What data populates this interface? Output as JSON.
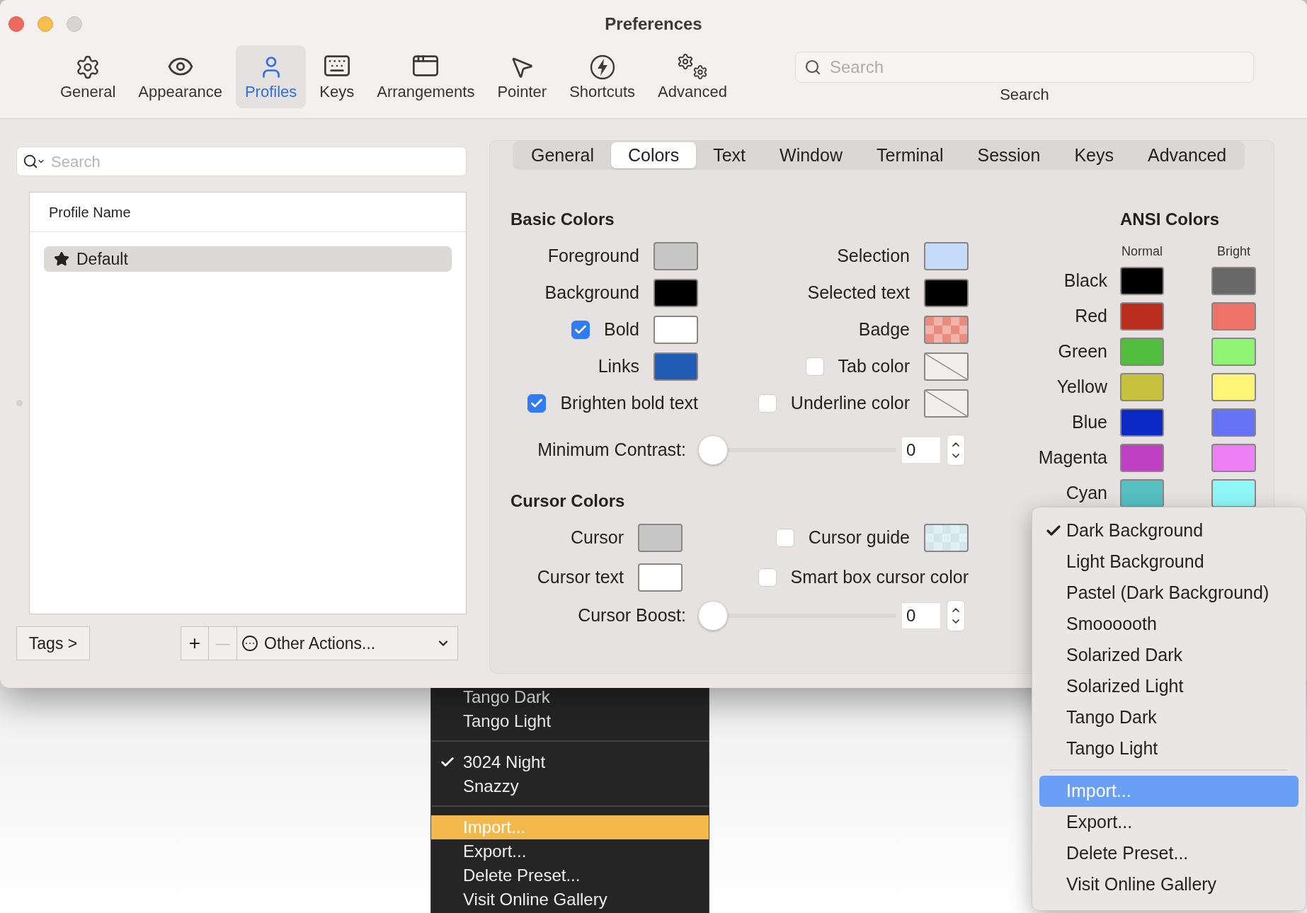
{
  "window": {
    "title": "Preferences"
  },
  "toolbar": [
    {
      "label": "General",
      "kind": "gear",
      "selected": false
    },
    {
      "label": "Appearance",
      "kind": "eye",
      "selected": false
    },
    {
      "label": "Profiles",
      "kind": "person",
      "selected": true
    },
    {
      "label": "Keys",
      "kind": "keyboard",
      "selected": false
    },
    {
      "label": "Arrangements",
      "kind": "windows",
      "selected": false
    },
    {
      "label": "Pointer",
      "kind": "pointer",
      "selected": false
    },
    {
      "label": "Shortcuts",
      "kind": "bolt",
      "selected": false
    },
    {
      "label": "Advanced",
      "kind": "gears",
      "selected": false
    }
  ],
  "search": {
    "placeholder": "Search",
    "label": "Search"
  },
  "profiles": {
    "search_placeholder": "Search",
    "column": "Profile Name",
    "rows": [
      {
        "name": "Default",
        "default": true,
        "selected": true
      }
    ]
  },
  "profile_buttons": {
    "tags": "Tags >",
    "add": {
      "label": "+",
      "disabled": false
    },
    "remove": {
      "label": "—",
      "disabled": true
    },
    "other_actions": "Other Actions..."
  },
  "tabs": [
    {
      "label": "General",
      "selected": false
    },
    {
      "label": "Colors",
      "selected": true
    },
    {
      "label": "Text",
      "selected": false
    },
    {
      "label": "Window",
      "selected": false
    },
    {
      "label": "Terminal",
      "selected": false
    },
    {
      "label": "Session",
      "selected": false
    },
    {
      "label": "Keys",
      "selected": false
    },
    {
      "label": "Advanced",
      "selected": false
    }
  ],
  "basic_colors": {
    "title": "Basic Colors",
    "rows": [
      {
        "left": {
          "label": "Foreground",
          "well": {
            "kind": "solid",
            "color": "#c6c6c6"
          }
        },
        "right": {
          "label": "Selection",
          "well": {
            "kind": "solid",
            "color": "#c6dbfa"
          }
        }
      },
      {
        "left": {
          "label": "Background",
          "well": {
            "kind": "solid",
            "color": "#000000"
          }
        },
        "right": {
          "label": "Selected text",
          "well": {
            "kind": "solid",
            "color": "#000000"
          }
        }
      },
      {
        "left": {
          "label": "Bold",
          "checked": true,
          "well": {
            "kind": "solid",
            "color": "#ffffff"
          }
        },
        "right": {
          "label": "Badge",
          "well": {
            "kind": "checker",
            "color": "#e98b7d"
          }
        }
      },
      {
        "left": {
          "label": "Links",
          "well": {
            "kind": "solid",
            "color": "#215bb6"
          }
        },
        "right": {
          "label": "Tab color",
          "checked": false,
          "well": {
            "kind": "empty"
          }
        }
      },
      {
        "left": {
          "label": "Brighten bold text",
          "checked": true
        },
        "right": {
          "label": "Underline color",
          "checked": false,
          "well": {
            "kind": "empty"
          }
        }
      }
    ],
    "minimum_contrast": {
      "label": "Minimum Contrast:",
      "level": 0,
      "value": "0"
    }
  },
  "cursor_colors": {
    "title": "Cursor Colors",
    "rows": [
      {
        "left": {
          "label": "Cursor",
          "well": {
            "kind": "solid",
            "color": "#c6c6c6"
          }
        },
        "right": {
          "label": "Cursor guide",
          "checked": false,
          "well": {
            "kind": "checker",
            "color": "#d3e6ec"
          }
        }
      },
      {
        "left": {
          "label": "Cursor text",
          "well": {
            "kind": "solid",
            "color": "#ffffff"
          }
        },
        "right": {
          "label": "Smart box cursor color",
          "checked": false
        }
      }
    ],
    "cursor_boost": {
      "label": "Cursor Boost:",
      "level": 0,
      "value": "0"
    }
  },
  "ansi_colors": {
    "title": "ANSI Colors",
    "columns": [
      "Normal",
      "Bright"
    ],
    "rows": [
      {
        "label": "Black",
        "normal": {
          "color": "#000000"
        },
        "bright": {
          "color": "#686868"
        }
      },
      {
        "label": "Red",
        "normal": {
          "color": "#b92d1c"
        },
        "bright": {
          "color": "#ef7268"
        }
      },
      {
        "label": "Green",
        "normal": {
          "color": "#52bc3c"
        },
        "bright": {
          "color": "#8ff374"
        }
      },
      {
        "label": "Yellow",
        "normal": {
          "color": "#c7c23d"
        },
        "bright": {
          "color": "#fef577"
        }
      },
      {
        "label": "Blue",
        "normal": {
          "color": "#0b2ac5"
        },
        "bright": {
          "color": "#6574f6"
        }
      },
      {
        "label": "Magenta",
        "normal": {
          "color": "#bf3fc2"
        },
        "bright": {
          "color": "#ee80f5"
        }
      },
      {
        "label": "Cyan",
        "normal": {
          "color": "#55bfc2"
        },
        "bright": {
          "color": "#8ff6f6"
        }
      }
    ]
  },
  "presets_menu": {
    "presets": [
      {
        "label": "Dark Background",
        "checked": true
      },
      {
        "label": "Light Background",
        "checked": false
      },
      {
        "label": "Pastel (Dark Background)",
        "checked": false
      },
      {
        "label": "Smoooooth",
        "checked": false
      },
      {
        "label": "Solarized Dark",
        "checked": false
      },
      {
        "label": "Solarized Light",
        "checked": false
      },
      {
        "label": "Tango Dark",
        "checked": false
      },
      {
        "label": "Tango Light",
        "checked": false
      }
    ],
    "actions": [
      {
        "label": "Import...",
        "selected": true
      },
      {
        "label": "Export...",
        "selected": false
      },
      {
        "label": "Delete Preset...",
        "selected": false
      },
      {
        "label": "Visit Online Gallery",
        "selected": false
      }
    ]
  },
  "background_menu": {
    "groups": [
      {
        "items": [
          {
            "label": "Tango Dark",
            "checked": false,
            "selected": false
          },
          {
            "label": "Tango Light",
            "checked": false,
            "selected": false
          }
        ]
      },
      {
        "items": [
          {
            "label": "3024 Night",
            "checked": true,
            "selected": false
          },
          {
            "label": "Snazzy",
            "checked": false,
            "selected": false
          }
        ]
      },
      {
        "items": [
          {
            "label": "Import...",
            "checked": false,
            "selected": true
          },
          {
            "label": "Export...",
            "checked": false,
            "selected": false
          },
          {
            "label": "Delete Preset...",
            "checked": false,
            "selected": false
          },
          {
            "label": "Visit Online Gallery",
            "checked": false,
            "selected": false
          }
        ]
      }
    ]
  }
}
